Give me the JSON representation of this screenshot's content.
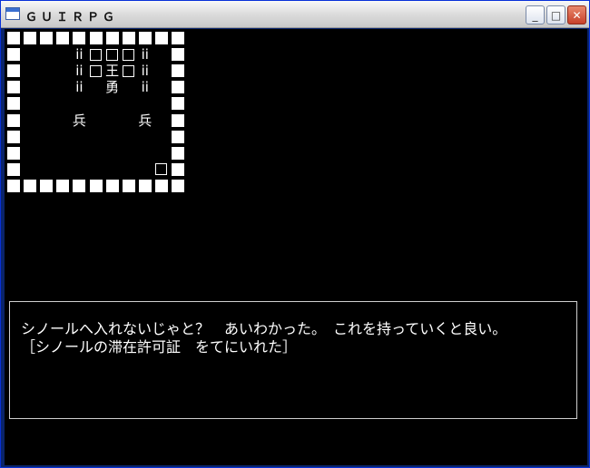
{
  "window": {
    "title": "ＧＵＩＲＰＧ",
    "min_glyph": "_",
    "max_glyph": "□",
    "close_glyph": "✕"
  },
  "map": {
    "rows": [
      "##########",
      "#   i   i#",
      "#   i   i#",
      "#        #",
      "#        #",
      "#        #",
      "#        #",
      "#       o#",
      "##########"
    ],
    "text_rows": [
      [
        "",
        "",
        "",
        "ii",
        "□",
        "□",
        "□",
        "ii",
        "",
        ""
      ],
      [
        "",
        "",
        "",
        "ii",
        "□",
        "王",
        "□",
        "ii",
        "",
        ""
      ],
      [
        "",
        "",
        "",
        "ii",
        "",
        "勇",
        "",
        "ii",
        "",
        ""
      ],
      [
        "",
        "",
        "",
        "",
        "",
        "",
        "",
        "",
        "",
        ""
      ],
      [
        "",
        "",
        "",
        "兵",
        "",
        "",
        "",
        "兵",
        "",
        ""
      ],
      [
        "",
        "",
        "",
        "",
        "",
        "",
        "",
        "",
        "",
        ""
      ],
      [
        "",
        "",
        "",
        "",
        "",
        "",
        "",
        "",
        "",
        ""
      ],
      [
        "",
        "",
        "",
        "",
        "",
        "",
        "",
        "",
        "□",
        ""
      ],
      [
        "",
        "",
        "",
        "",
        "",
        "",
        "",
        "",
        "",
        ""
      ]
    ]
  },
  "message": {
    "line1": "シノールへ入れないじゃと？　あいわかった。　これを持っていくと良い。",
    "line2": "［シノールの滞在許可証　をてにいれた］"
  }
}
